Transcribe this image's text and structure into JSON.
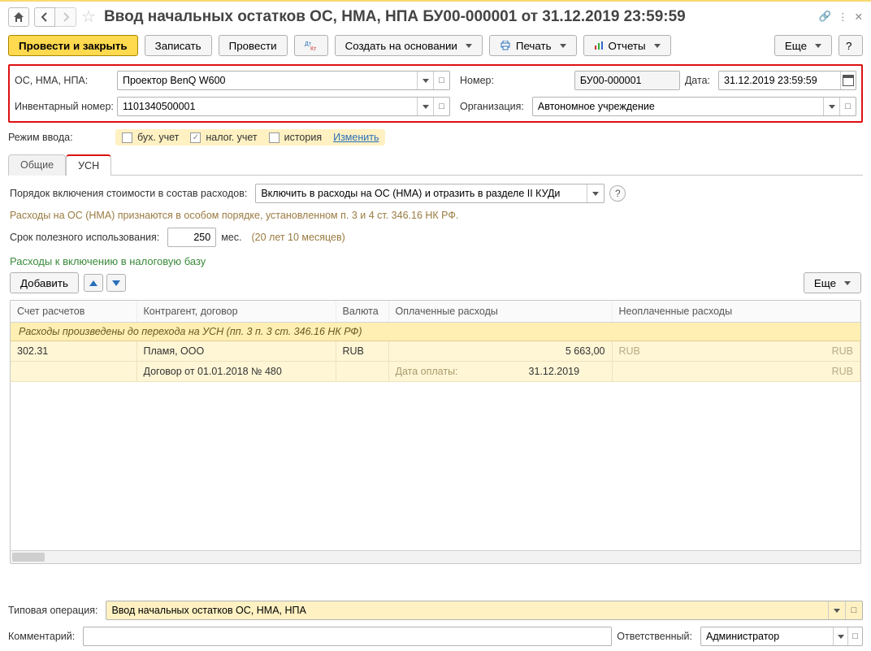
{
  "header": {
    "title": "Ввод начальных остатков ОС, НМА, НПА БУ00-000001 от 31.12.2019 23:59:59"
  },
  "toolbar": {
    "post_close": "Провести и закрыть",
    "save": "Записать",
    "post": "Провести",
    "create_based": "Создать на основании",
    "print": "Печать",
    "reports": "Отчеты",
    "more": "Еще",
    "help": "?"
  },
  "fields": {
    "os_label": "ОС, НМА, НПА:",
    "os_value": "Проектор BenQ W600",
    "num_label": "Номер:",
    "num_value": "БУ00-000001",
    "date_label": "Дата:",
    "date_value": "31.12.2019 23:59:59",
    "inv_label": "Инвентарный номер:",
    "inv_value": "1101340500001",
    "org_label": "Организация:",
    "org_value": "Автономное учреждение",
    "mode_label": "Режим ввода:",
    "chk_buh": "бух. учет",
    "chk_nal": "налог. учет",
    "chk_hist": "история",
    "change_lnk": "Изменить"
  },
  "tabs": {
    "t1": "Общие",
    "t2": "УСН"
  },
  "usn": {
    "order_label": "Порядок включения стоимости в состав расходов:",
    "order_value": "Включить в расходы на ОС (НМА) и отразить в разделе II КУДи",
    "hint": "Расходы на ОС (НМА) признаются в особом порядке, установленном п. 3 и 4 ст. 346.16 НК РФ.",
    "spi_label": "Срок полезного использования:",
    "spi_value": "250",
    "spi_unit": "мес.",
    "spi_text": "(20 лет 10 месяцев)",
    "sec_title": "Расходы к включению в налоговую базу",
    "add_btn": "Добавить",
    "more_btn": "Еще"
  },
  "table": {
    "h_account": "Счет расчетов",
    "h_agent": "Контрагент, договор",
    "h_cur": "Валюта",
    "h_paid": "Оплаченные расходы",
    "h_unpaid": "Неоплаченные расходы",
    "band": "Расходы произведены до перехода на УСН (пп. 3 п. 3 ст. 346.16 НК РФ)",
    "r1_account": "302.31",
    "r1_agent": "Пламя, ООО",
    "r1_cur": "RUB",
    "r1_paid": "5 663,00",
    "r1_paid_cur": "RUB",
    "r1_unpaid_cur": "RUB",
    "r2_agent": "Договор от 01.01.2018 № 480",
    "r2_paid_lbl": "Дата оплаты:",
    "r2_paid_val": "31.12.2019",
    "r2_unpaid_cur": "RUB"
  },
  "footer": {
    "typ_label": "Типовая операция:",
    "typ_value": "Ввод начальных остатков ОС, НМА, НПА",
    "comment_label": "Комментарий:",
    "resp_label": "Ответственный:",
    "resp_value": "Администратор"
  }
}
